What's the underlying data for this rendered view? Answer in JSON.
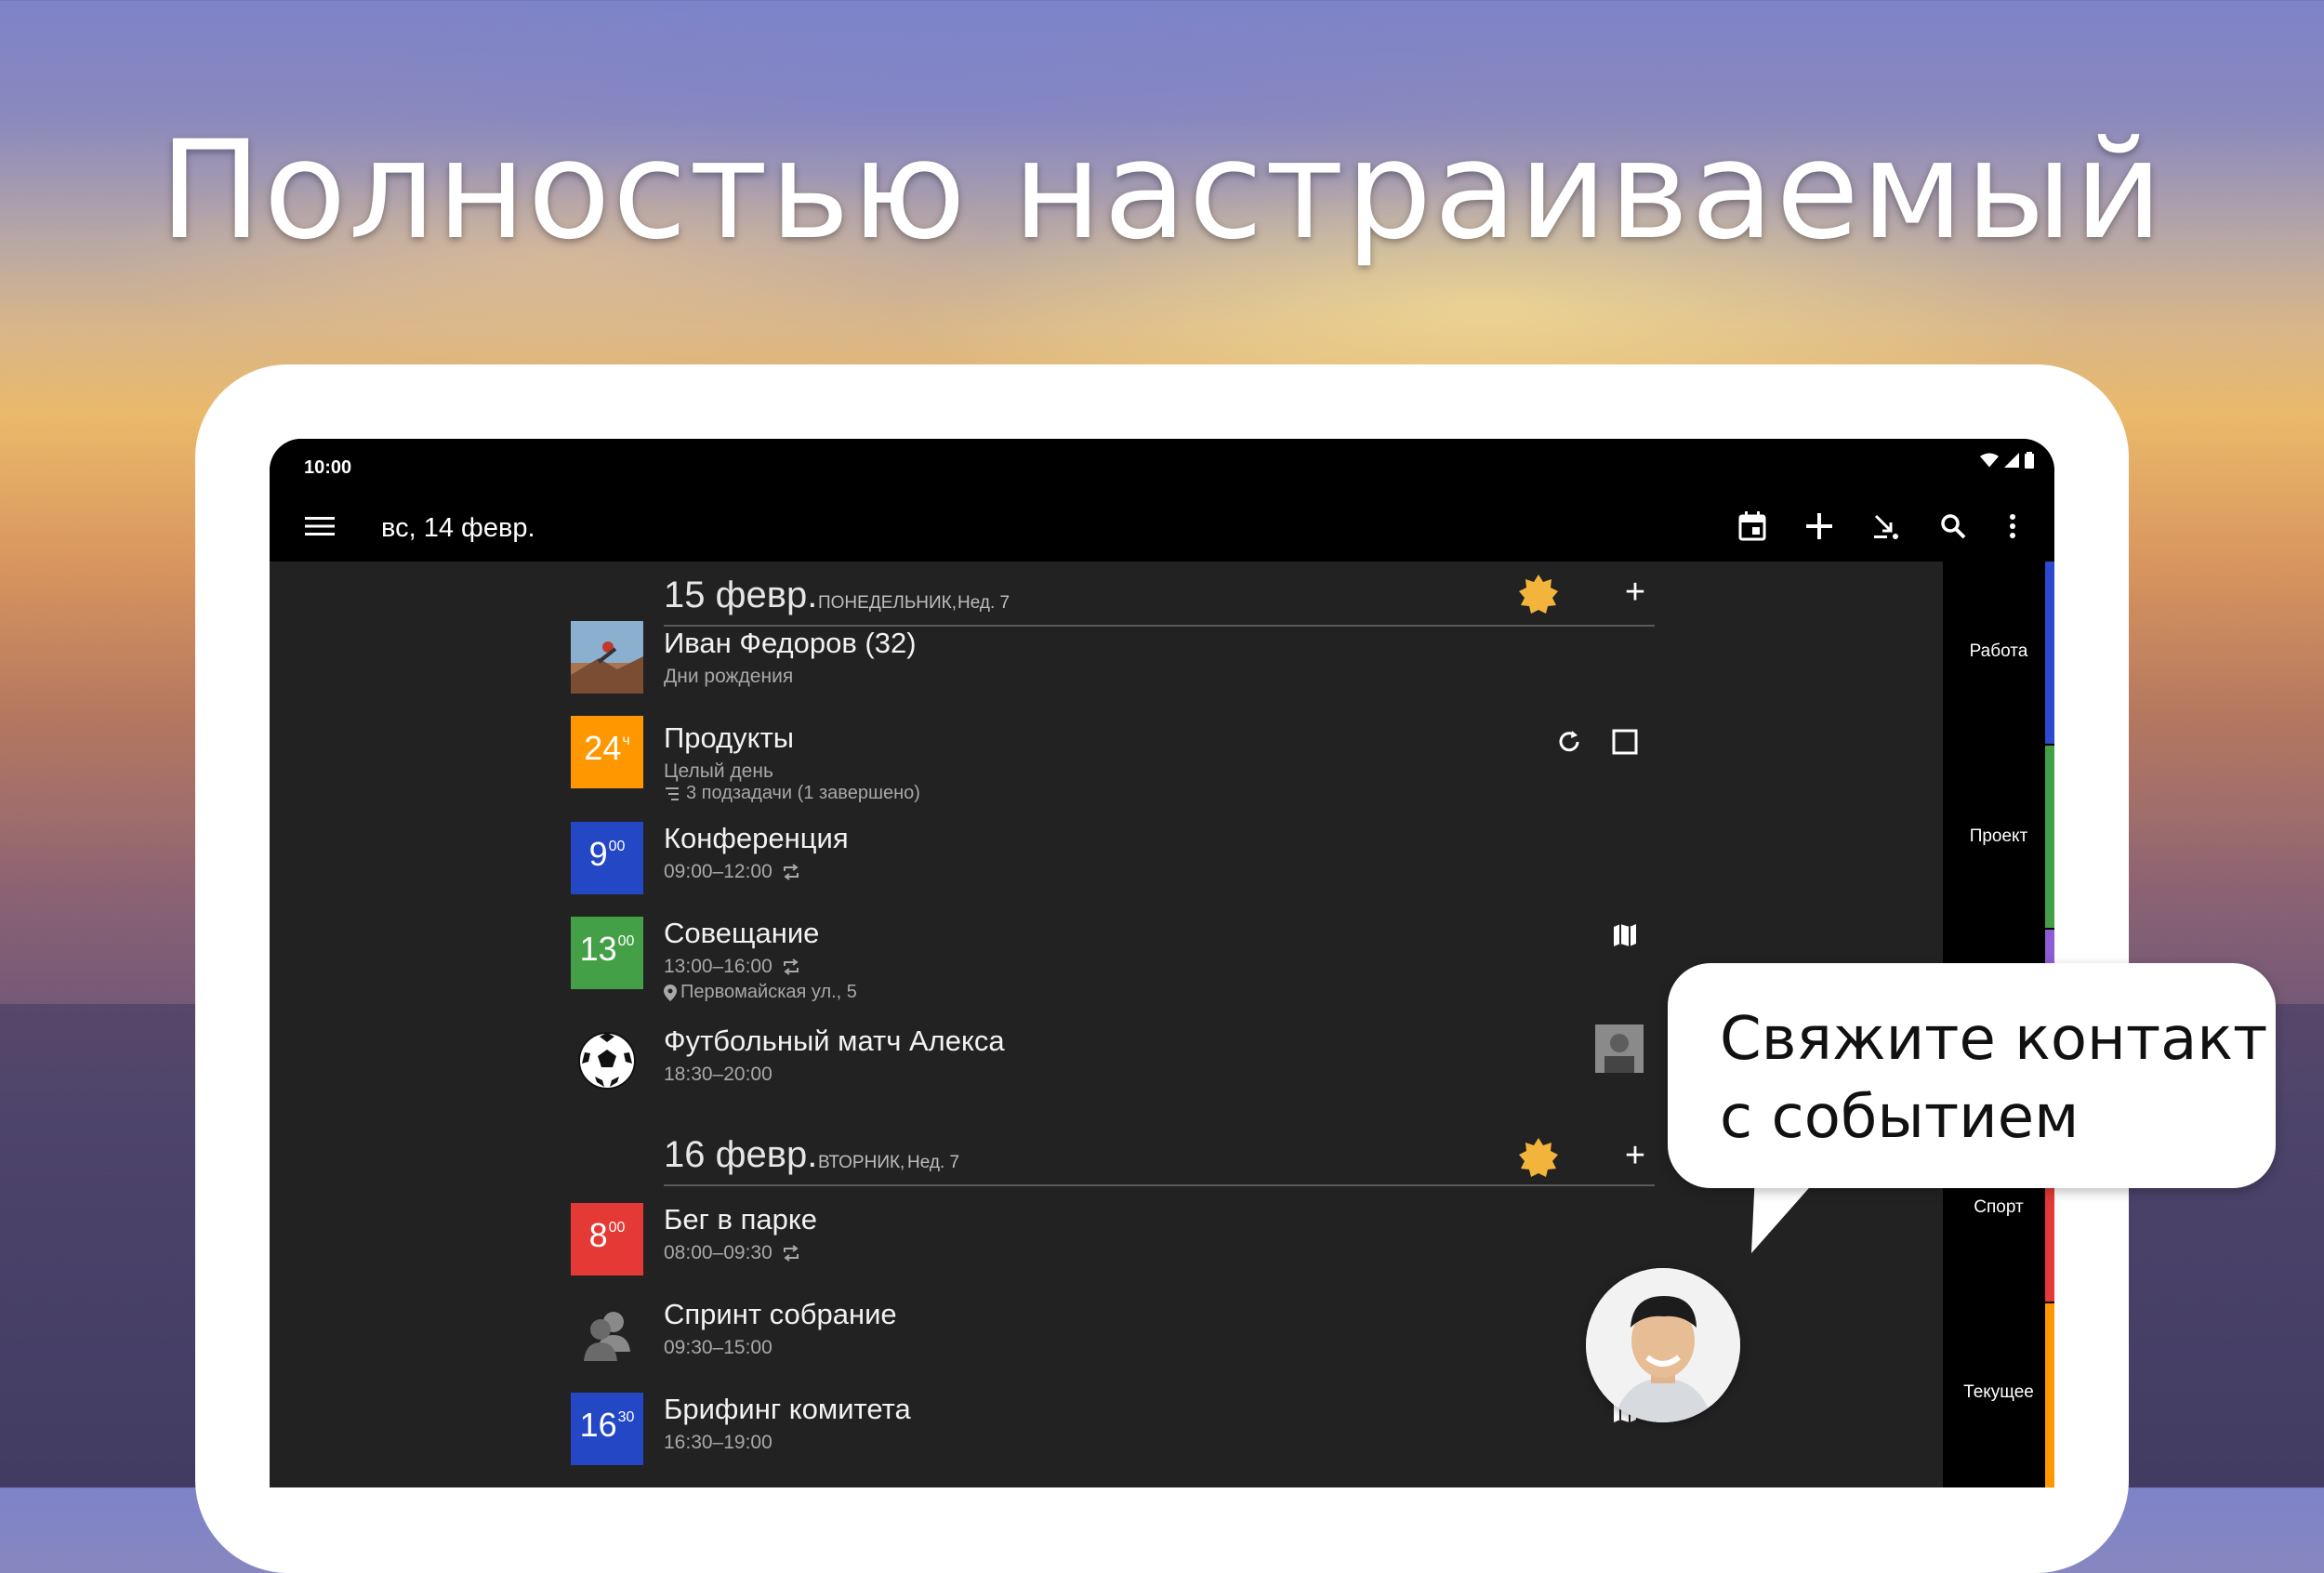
{
  "headline": "Полностью настраиваемый",
  "status_bar": {
    "time": "10:00"
  },
  "toolbar": {
    "title": "вс, 14 февр."
  },
  "days": [
    {
      "date": "15 февр.",
      "weekday": "ПОНЕДЕЛЬНИК,",
      "week": "Нед. 7",
      "events": [
        {
          "title": "Иван Федоров (32)",
          "subtitle": "Дни рождения",
          "badge_type": "photo"
        },
        {
          "title": "Продукты",
          "subtitle": "Целый день",
          "detail": "3 подзадачи (1 завершено)",
          "badge_main": "24",
          "badge_sup": "ч",
          "badge_color": "#ff9800"
        },
        {
          "title": "Конференция",
          "subtitle": "09:00–12:00",
          "badge_main": "9",
          "badge_sup": "00",
          "badge_color": "#2347c5"
        },
        {
          "title": "Совещание",
          "subtitle": "13:00–16:00",
          "detail": "Первомайская ул., 5",
          "badge_main": "13",
          "badge_sup": "00",
          "badge_color": "#43a047"
        },
        {
          "title": "Футбольный матч Алекса",
          "subtitle": "18:30–20:00",
          "badge_type": "soccer-ball"
        }
      ]
    },
    {
      "date": "16 февр.",
      "weekday": "ВТОРНИК,",
      "week": "Нед. 7",
      "events": [
        {
          "title": "Бег в парке",
          "subtitle": "08:00–09:30",
          "badge_main": "8",
          "badge_sup": "00",
          "badge_color": "#e53935"
        },
        {
          "title": "Спринт собрание",
          "subtitle": "09:30–15:00",
          "badge_type": "people"
        },
        {
          "title": "Брифинг комитета",
          "subtitle": "16:30–19:00",
          "badge_main": "16",
          "badge_sup": "30",
          "badge_color": "#2347c5"
        }
      ]
    }
  ],
  "categories": [
    {
      "label": "Работа",
      "color": "#2c49d0"
    },
    {
      "label": "Проект",
      "color": "#43a047"
    },
    {
      "label": "Спорт",
      "color": "#e53935"
    },
    {
      "label": "Текущее",
      "color": "#ff9800"
    }
  ],
  "callout": {
    "line1": "Свяжите контакт",
    "line2": "с событием"
  }
}
